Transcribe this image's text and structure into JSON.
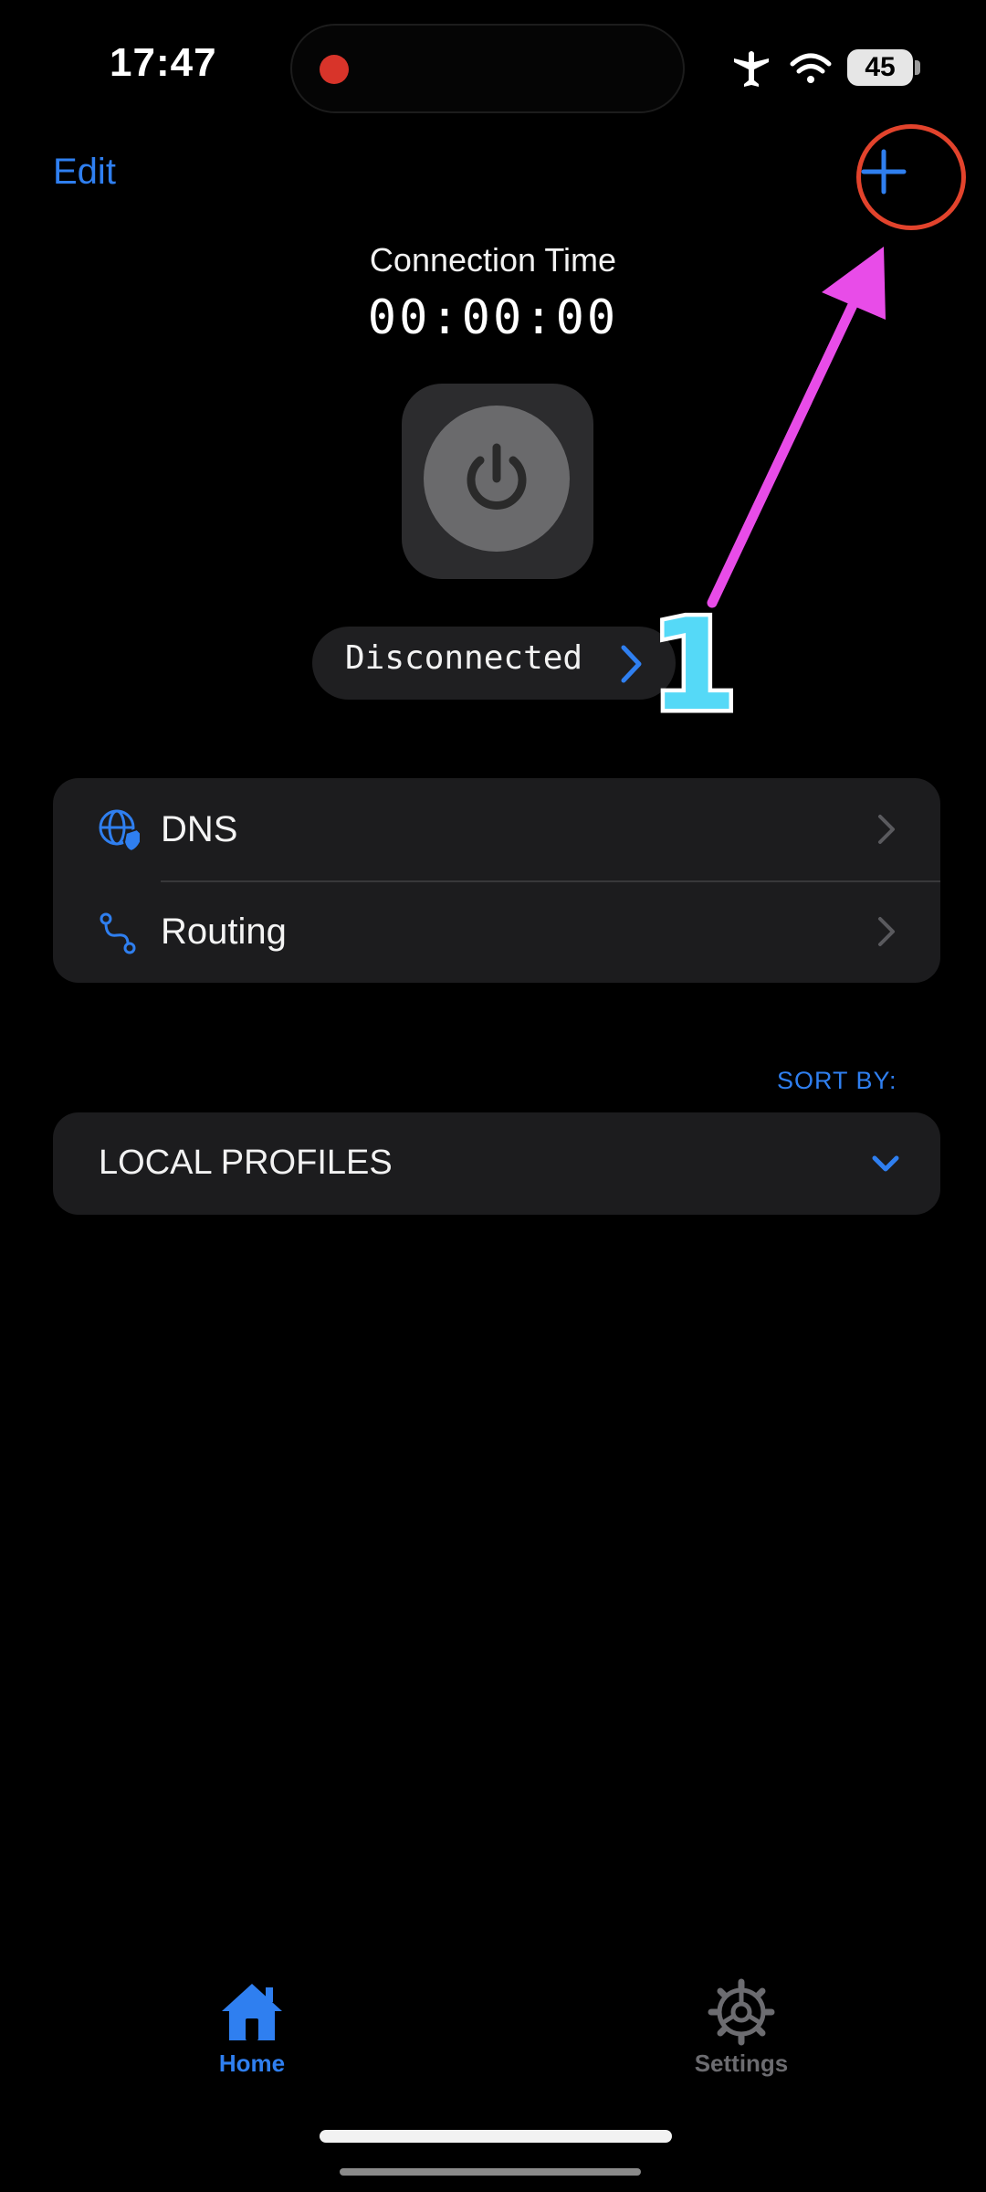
{
  "status_bar": {
    "time": "17:47",
    "battery": "45"
  },
  "nav": {
    "edit_label": "Edit"
  },
  "connection": {
    "title": "Connection Time",
    "time": "00:00:00",
    "status": "Disconnected"
  },
  "annotation": {
    "step": "1"
  },
  "settings_list": {
    "items": [
      {
        "label": "DNS",
        "icon": "globe-shield-icon"
      },
      {
        "label": "Routing",
        "icon": "route-icon"
      }
    ]
  },
  "profiles": {
    "sort_label": "SORT BY:",
    "section_label": "LOCAL PROFILES"
  },
  "tabs": [
    {
      "label": "Home",
      "icon": "house-icon",
      "active": true
    },
    {
      "label": "Settings",
      "icon": "gear-icon",
      "active": false
    }
  ],
  "colors": {
    "accent": "#2f7ff0",
    "highlight_ring": "#e2432c",
    "arrow": "#e84ce8",
    "step_number": "#55d9f7",
    "record": "#d8342a"
  }
}
